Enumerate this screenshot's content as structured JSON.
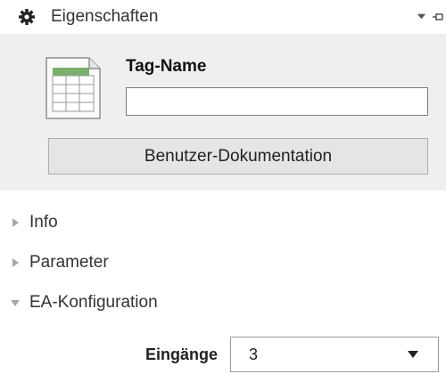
{
  "panel": {
    "title": "Eigenschaften",
    "icons": {
      "title": "gear-icon",
      "pin": "pin-icon",
      "menu": "dropdown-arrow-icon",
      "block": "table-block-icon"
    }
  },
  "header": {
    "tag_name_label": "Tag-Name",
    "tag_name_value": "",
    "doc_button_label": "Benutzer-Dokumentation"
  },
  "sections": [
    {
      "label": "Info",
      "expanded": false
    },
    {
      "label": "Parameter",
      "expanded": false
    },
    {
      "label": "EA-Konfiguration",
      "expanded": true
    }
  ],
  "ea_config": {
    "inputs_label": "Eingänge",
    "inputs_value": "3"
  },
  "colors": {
    "panel_bg": "#efefef",
    "button_bg": "#e5e5e5",
    "icon_green": "#7ab06b"
  }
}
